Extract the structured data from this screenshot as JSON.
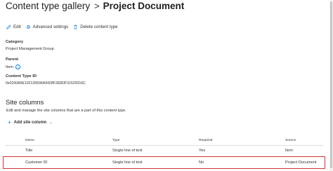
{
  "breadcrumb": {
    "parent": "Content type gallery",
    "separator": ">",
    "current": "Project Document"
  },
  "toolbar": {
    "edit": "Edit",
    "advanced_settings": "Advanced settings",
    "delete": "Delete content type"
  },
  "details": {
    "category_label": "Category",
    "category_value": "Project Management Group",
    "parent_label": "Parent",
    "parent_value": "Item",
    "id_label": "Content Type ID",
    "id_value": "0x0100A0E102126696A9428F2E8DF31529316C"
  },
  "site_columns": {
    "title": "Site columns",
    "description": "Edit and manage the site columns that are a part of this content type.",
    "add_label": "Add site column",
    "headers": [
      "Name",
      "Type",
      "Required",
      "Source"
    ],
    "rows": [
      {
        "name": "Title",
        "type": "Single line of text",
        "required": "Yes",
        "source": "Item"
      },
      {
        "name": "Customer ID",
        "type": "Single line of text",
        "required": "No",
        "source": "Project Document"
      }
    ]
  },
  "colors": {
    "accent": "#0078d4",
    "highlight": "#d13438",
    "divider": "#e1dfdd"
  }
}
